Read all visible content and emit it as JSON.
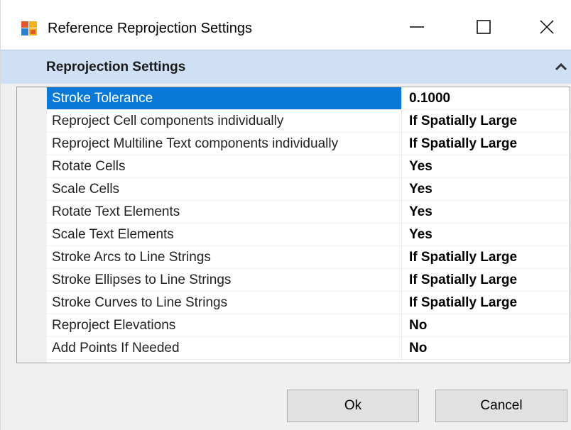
{
  "window": {
    "title": "Reference Reprojection Settings"
  },
  "section": {
    "title": "Reprojection Settings"
  },
  "properties": [
    {
      "name": "Stroke Tolerance",
      "value": "0.1000",
      "selected": true
    },
    {
      "name": "Reproject Cell components individually",
      "value": "If Spatially Large"
    },
    {
      "name": "Reproject Multiline Text components individually",
      "value": "If Spatially Large"
    },
    {
      "name": "Rotate Cells",
      "value": "Yes"
    },
    {
      "name": "Scale Cells",
      "value": "Yes"
    },
    {
      "name": "Rotate Text Elements",
      "value": "Yes"
    },
    {
      "name": "Scale Text Elements",
      "value": "Yes"
    },
    {
      "name": "Stroke Arcs to Line Strings",
      "value": "If Spatially Large"
    },
    {
      "name": "Stroke Ellipses to Line Strings",
      "value": "If Spatially Large"
    },
    {
      "name": "Stroke Curves to Line Strings",
      "value": "If Spatially Large"
    },
    {
      "name": "Reproject Elevations",
      "value": "No"
    },
    {
      "name": "Add Points If Needed",
      "value": "No"
    }
  ],
  "buttons": {
    "ok": "Ok",
    "cancel": "Cancel"
  },
  "icons": {
    "app": "reprojection-app-icon",
    "minimize": "minimize-icon",
    "maximize": "maximize-icon",
    "close": "close-icon",
    "collapse": "chevron-up-icon"
  },
  "colors": {
    "selection": "#0a78d7",
    "section_header": "#cfe0f4",
    "dialog_background": "#f0f0f0"
  }
}
